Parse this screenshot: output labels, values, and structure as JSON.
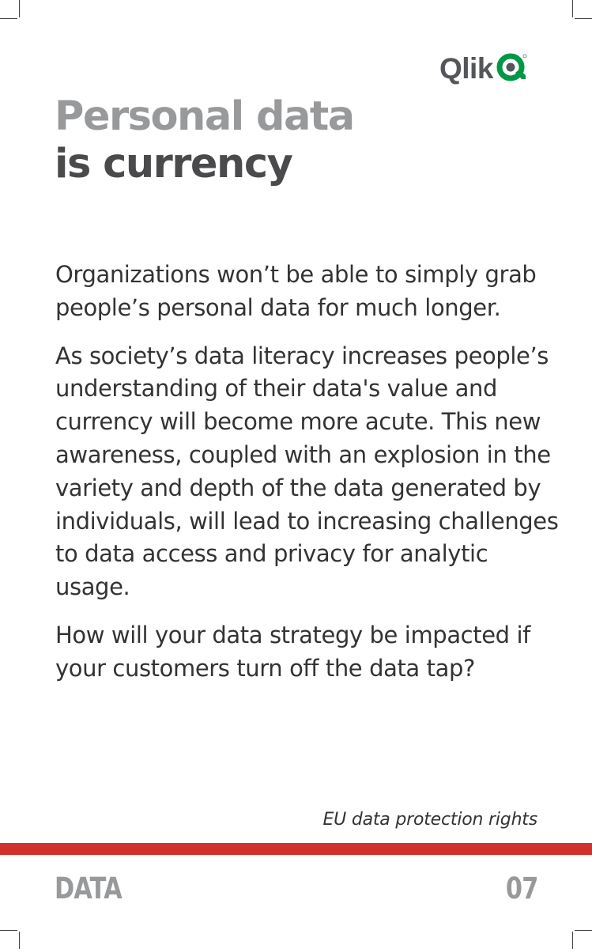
{
  "brand": {
    "name": "Qlik",
    "accent_color": "#009845",
    "text_color": "#54565a"
  },
  "title": {
    "line1": "Personal data",
    "line2": "is currency"
  },
  "paragraphs": [
    "Organizations won’t be able to simply grab people’s personal data for much longer.",
    "As society’s data literacy increases people’s understanding of their data's value and currency will become more acute. This new awareness, coupled with an explosion in the variety and depth of the data generated by individuals, will lead to increasing challenges to data access and privacy for analytic usage.",
    "How will your data strategy be impacted if your customers turn off the data tap?"
  ],
  "footnote": "EU data protection rights",
  "footer": {
    "category": "DATA",
    "page_number": "07",
    "divider_color": "#d0312d"
  }
}
